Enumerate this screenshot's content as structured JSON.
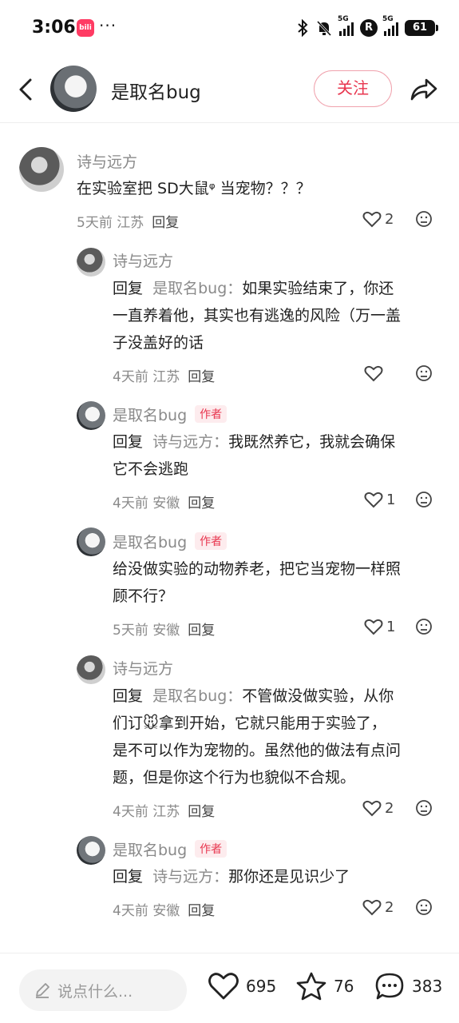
{
  "status_bar": {
    "time": "3:06",
    "app_icon_text": "bili",
    "more": "···",
    "network_1": "5G",
    "network_2": "5G",
    "r_badge": "R",
    "battery": "61"
  },
  "header": {
    "name": "是取名bug",
    "follow_label": "关注"
  },
  "comments": [
    {
      "name": "诗与远方",
      "text_lines": [
        "在实验室把 SD大鼠ᵠ 当宠物？？？"
      ],
      "meta": "5天前 江苏",
      "reply": "回复",
      "likes": "2"
    },
    {
      "name": "诗与远方",
      "reply_word": "回复",
      "reply_to": "是取名bug：",
      "text_first": "如果实验结束了，你还",
      "text_lines": [
        "一直养着他，其实也有逃逸的风险（万一盖",
        "子没盖好的话"
      ],
      "meta": "4天前 江苏",
      "reply": "回复",
      "likes": ""
    },
    {
      "name": "是取名bug",
      "author_tag": "作者",
      "reply_word": "回复",
      "reply_to": "诗与远方：",
      "text_first": "我既然养它，我就会确保",
      "text_lines": [
        "它不会逃跑"
      ],
      "meta": "4天前 安徽",
      "reply": "回复",
      "likes": "1"
    },
    {
      "name": "是取名bug",
      "author_tag": "作者",
      "text_lines": [
        "给没做实验的动物养老，把它当宠物一样照",
        "顾不行？"
      ],
      "meta": "5天前 安徽",
      "reply": "回复",
      "likes": "1"
    },
    {
      "name": "诗与远方",
      "reply_word": "回复",
      "reply_to": "是取名bug：",
      "text_first": "不管做没做实验，从你",
      "text_lines": [
        "们订🐭拿到开始，它就只能用于实验了，",
        "是不可以作为宠物的。虽然他的做法有点问",
        "题，但是你这个行为也貌似不合规。"
      ],
      "meta": "4天前 江苏",
      "reply": "回复",
      "likes": "2"
    },
    {
      "name": "是取名bug",
      "author_tag": "作者",
      "reply_word": "回复",
      "reply_to": "诗与远方：",
      "text_first": "那你还是见识少了",
      "text_lines": [],
      "meta": "4天前 安徽",
      "reply": "回复",
      "likes": "2"
    }
  ],
  "bottom_bar": {
    "placeholder": "说点什么...",
    "likes": "695",
    "favorites": "76",
    "comments": "383"
  },
  "colors": {
    "accent": "#e8364f",
    "follow_border": "#f0a2ad",
    "secondary_text": "#8a8a8a"
  }
}
